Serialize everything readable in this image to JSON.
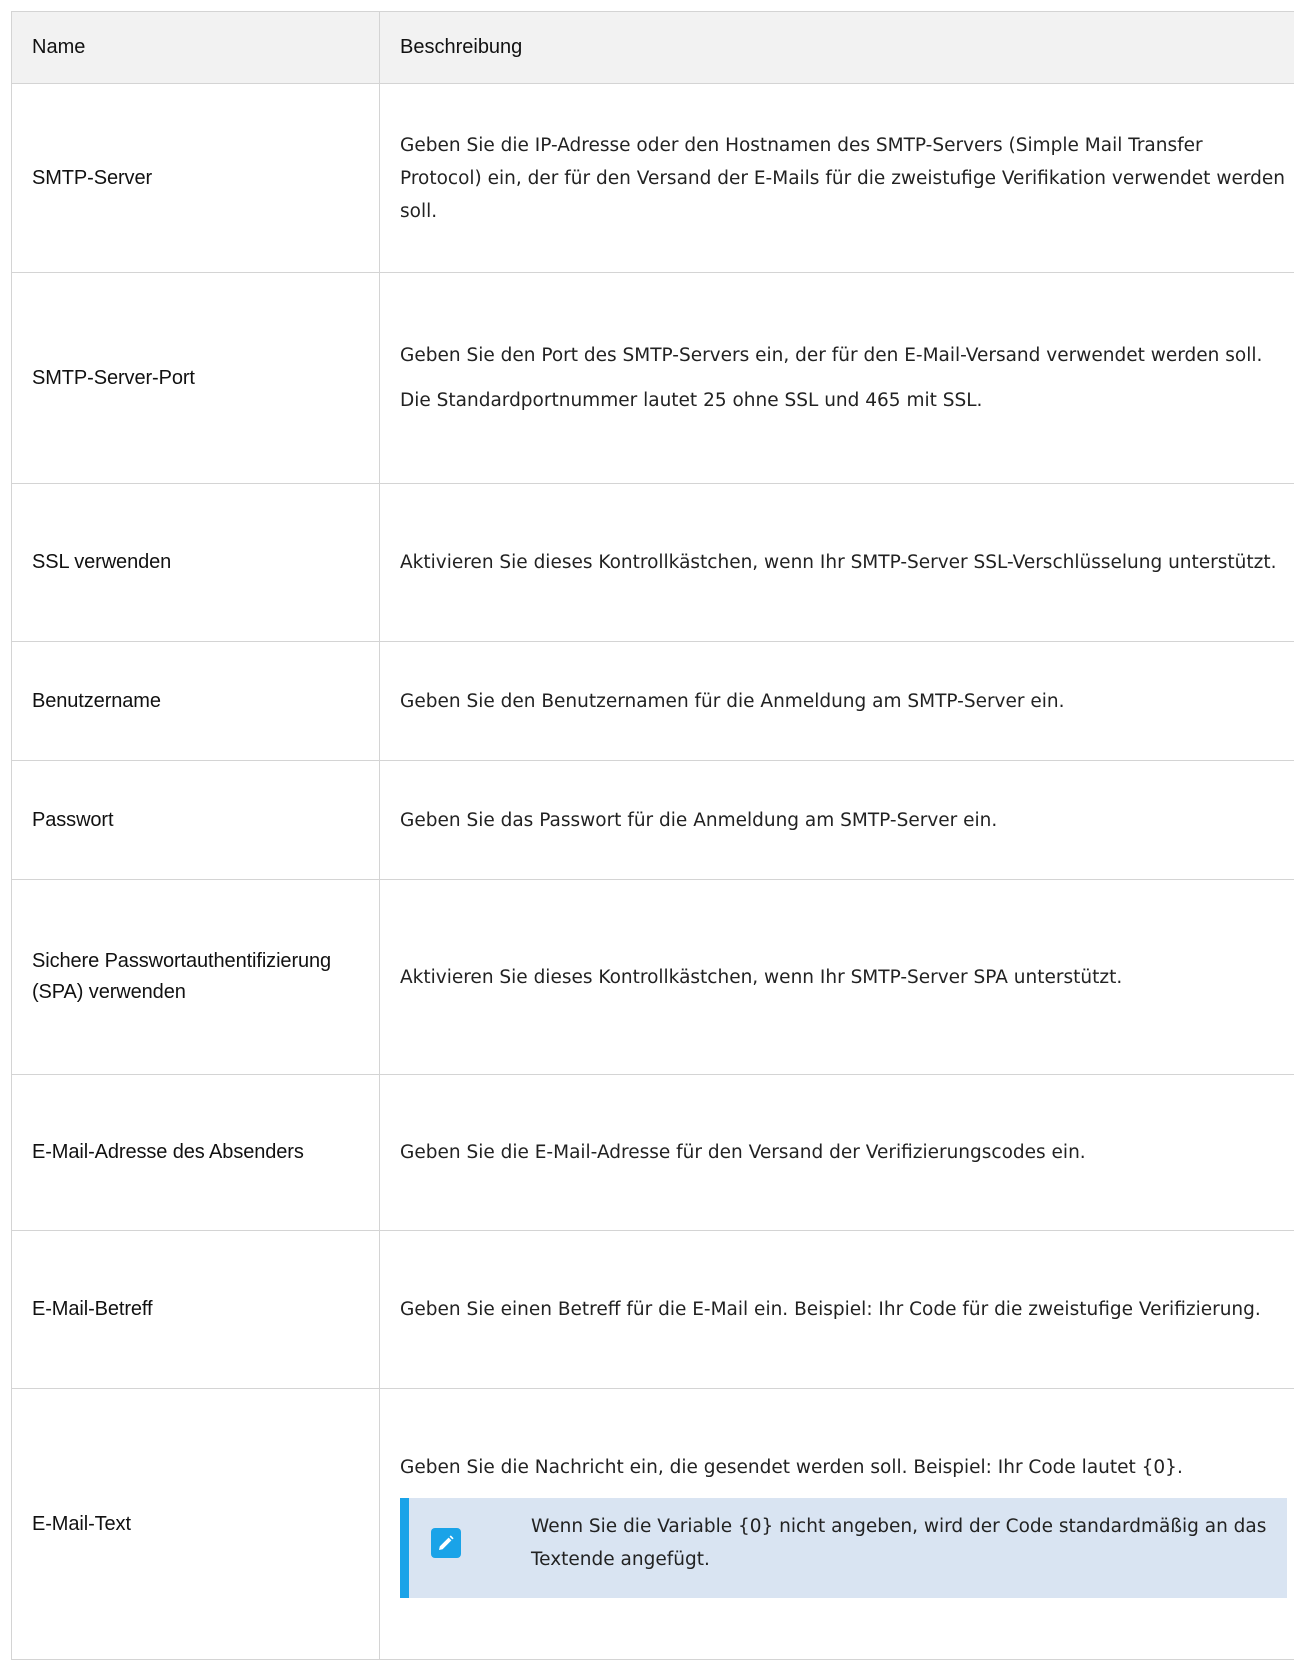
{
  "table": {
    "headers": {
      "name": "Name",
      "description": "Beschreibung"
    },
    "rows": [
      {
        "name": "SMTP-Server",
        "description": [
          "Geben Sie die IP-Adresse oder den Hostnamen des SMTP-Servers (Simple Mail Transfer Protocol) ein, der für den Versand der E-Mails für die zweistufige Verifikation verwendet werden soll."
        ]
      },
      {
        "name": "SMTP-Server-Port",
        "description": [
          "Geben Sie den Port des SMTP-Servers ein, der für den E-Mail-Versand verwendet werden soll.",
          "Die Standardportnummer lautet 25 ohne SSL und 465 mit SSL."
        ]
      },
      {
        "name": "SSL verwenden",
        "description": [
          "Aktivieren Sie dieses Kontrollkästchen, wenn Ihr SMTP-Server SSL-Verschlüsselung unterstützt."
        ]
      },
      {
        "name": "Benutzername",
        "description": [
          "Geben Sie den Benutzernamen für die Anmeldung am SMTP-Server ein."
        ]
      },
      {
        "name": "Passwort",
        "description": [
          "Geben Sie das Passwort für die Anmeldung am SMTP-Server ein."
        ]
      },
      {
        "name": "Sichere Passwortauthentifizierung (SPA) verwenden",
        "description": [
          "Aktivieren Sie dieses Kontrollkästchen, wenn Ihr SMTP-Server SPA unterstützt."
        ]
      },
      {
        "name": "E-Mail-Adresse des Absenders",
        "description": [
          "Geben Sie die E-Mail-Adresse für den Versand der Verifizierungscodes ein."
        ]
      },
      {
        "name": "E-Mail-Betreff",
        "description": [
          "Geben Sie einen Betreff für die E-Mail ein. Beispiel: Ihr Code für die zweistufige Verifizierung."
        ]
      },
      {
        "name": "E-Mail-Text",
        "description": [
          "Geben Sie die Nachricht ein, die gesendet werden soll. Beispiel: Ihr Code lautet {0}."
        ],
        "note": {
          "icon": "pencil-icon",
          "text": "Wenn Sie die Variable {0} nicht angeben, wird der Code standardmäßig an das Textende angefügt."
        }
      }
    ]
  },
  "colors": {
    "header_bg": "#f2f2f2",
    "border": "#d4d4d4",
    "note_bg": "#d9e4f2",
    "note_accent": "#1aa3e8"
  }
}
